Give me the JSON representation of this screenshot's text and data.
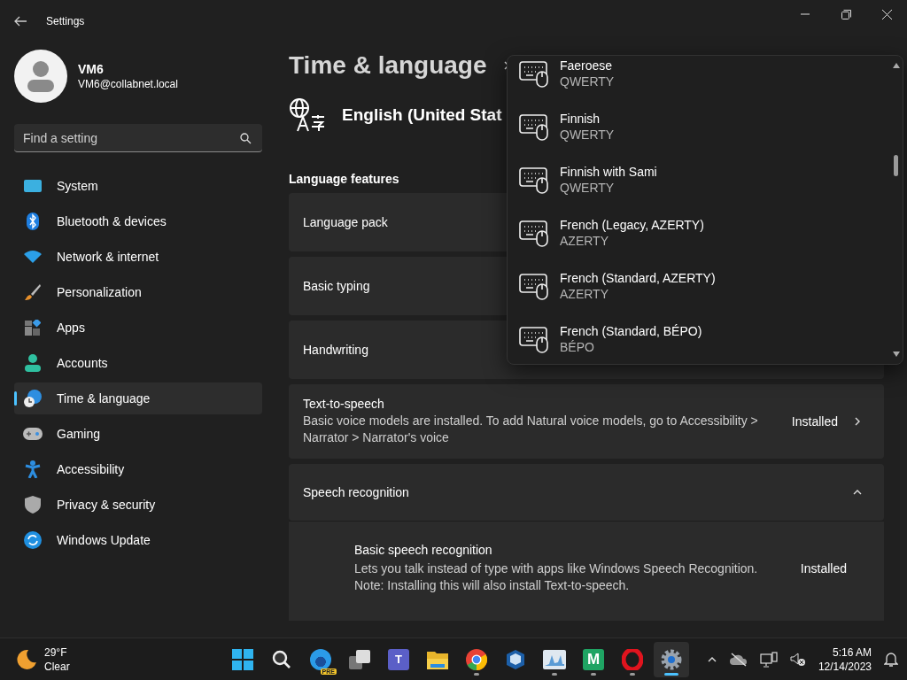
{
  "window": {
    "title": "Settings"
  },
  "profile": {
    "name": "VM6",
    "email": "VM6@collabnet.local"
  },
  "search": {
    "placeholder": "Find a setting"
  },
  "sidebar": {
    "items": [
      {
        "label": "System",
        "selected": false
      },
      {
        "label": "Bluetooth & devices",
        "selected": false
      },
      {
        "label": "Network & internet",
        "selected": false
      },
      {
        "label": "Personalization",
        "selected": false
      },
      {
        "label": "Apps",
        "selected": false
      },
      {
        "label": "Accounts",
        "selected": false
      },
      {
        "label": "Time & language",
        "selected": true
      },
      {
        "label": "Gaming",
        "selected": false
      },
      {
        "label": "Accessibility",
        "selected": false
      },
      {
        "label": "Privacy & security",
        "selected": false
      },
      {
        "label": "Windows Update",
        "selected": false
      }
    ]
  },
  "page": {
    "breadcrumb": "Time & language",
    "language": "English (United Stat"
  },
  "language_features": {
    "heading": "Language features",
    "items": [
      {
        "kind": "simple",
        "title": "Language pack"
      },
      {
        "kind": "simple",
        "title": "Basic typing"
      },
      {
        "kind": "simple",
        "title": "Handwriting"
      },
      {
        "kind": "detail",
        "title": "Text-to-speech",
        "description": "Basic voice models are installed. To add Natural voice models, go to Accessibility > Narrator > Narrator's voice",
        "status": "Installed"
      },
      {
        "kind": "expander",
        "title": "Speech recognition",
        "expanded": true,
        "children": [
          {
            "title": "Basic speech recognition",
            "description": "Lets you talk instead of type with apps like Windows Speech Recognition. Note: Installing this will also install Text-to-speech.",
            "status": "Installed"
          }
        ]
      }
    ]
  },
  "keyboard_list": {
    "items": [
      {
        "name": "Faeroese",
        "layout": "QWERTY"
      },
      {
        "name": "Finnish",
        "layout": "QWERTY"
      },
      {
        "name": "Finnish with Sami",
        "layout": "QWERTY"
      },
      {
        "name": "French (Legacy, AZERTY)",
        "layout": "AZERTY"
      },
      {
        "name": "French (Standard, AZERTY)",
        "layout": "AZERTY"
      },
      {
        "name": "French (Standard, BÉPO)",
        "layout": "BÉPO"
      }
    ]
  },
  "taskbar": {
    "weather": {
      "temperature": "29°F",
      "condition": "Clear"
    },
    "apps": [
      {
        "running": false,
        "selected": false
      },
      {
        "running": false,
        "selected": false
      },
      {
        "badge": "PRE",
        "running": false,
        "selected": false
      },
      {
        "running": false,
        "selected": false
      },
      {
        "letter": "T",
        "running": false,
        "selected": false
      },
      {
        "running": false,
        "selected": false
      },
      {
        "running": true,
        "selected": false
      },
      {
        "running": false,
        "selected": false
      },
      {
        "running": true,
        "selected": false
      },
      {
        "letter": "M",
        "running": true,
        "selected": false
      },
      {
        "running": true,
        "selected": false
      },
      {
        "running": true,
        "selected": true
      }
    ],
    "time": "5:16 AM",
    "date": "12/14/2023"
  }
}
